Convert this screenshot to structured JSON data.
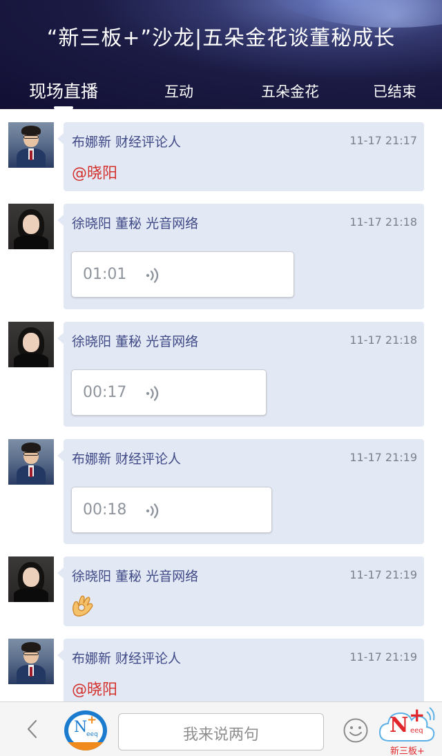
{
  "header": {
    "title": "“新三板+”沙龙|五朵金花谈董秘成长",
    "tabs": [
      {
        "label": "现场直播",
        "active": true
      },
      {
        "label": "互动",
        "active": false
      },
      {
        "label": "五朵金花",
        "active": false
      },
      {
        "label": "已结束",
        "active": false
      }
    ]
  },
  "messages": [
    {
      "author": "布娜新  财经评论人",
      "time": "11-17 21:17",
      "type": "text",
      "text": "@晓阳",
      "avatar": "male-avatar"
    },
    {
      "author": "徐晓阳 董秘  光音网络",
      "time": "11-17 21:18",
      "type": "voice",
      "duration": "01:01",
      "avatar": "female-avatar"
    },
    {
      "author": "徐晓阳 董秘  光音网络",
      "time": "11-17 21:18",
      "type": "voice",
      "duration": "00:17",
      "avatar": "female-avatar"
    },
    {
      "author": "布娜新  财经评论人",
      "time": "11-17 21:19",
      "type": "voice",
      "duration": "00:18",
      "avatar": "male-avatar"
    },
    {
      "author": "徐晓阳 董秘  光音网络",
      "time": "11-17 21:19",
      "type": "emoji",
      "emoji": "ok-hand-emoji",
      "avatar": "female-avatar"
    },
    {
      "author": "布娜新  财经评论人",
      "time": "11-17 21:19",
      "type": "text",
      "text": "@晓阳",
      "avatar": "male-avatar"
    }
  ],
  "bottom_bar": {
    "input_placeholder": "我来说两句",
    "logo_text": "N",
    "logo_sub": "eeq",
    "brand_label": "新三板+",
    "brand_sub": "eeq"
  },
  "colors": {
    "bubble": "#e3e8f5",
    "author": "#3f4a86",
    "mention": "#d3302b",
    "brand": "#e0262b"
  }
}
